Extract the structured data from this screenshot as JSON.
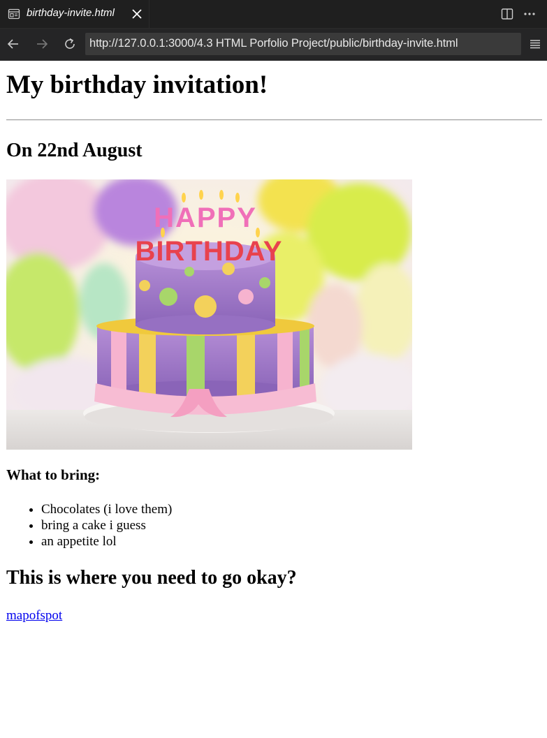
{
  "editor": {
    "tab_title": "birthday-invite.html",
    "tab_icon": "preview-icon",
    "close_icon": "close-icon",
    "split_icon": "split-editor-icon",
    "more_icon": "ellipsis-icon"
  },
  "browser": {
    "url": "http://127.0.0.1:3000/4.3 HTML Porfolio Project/public/birthday-invite.html",
    "back_icon": "arrow-left-icon",
    "forward_icon": "arrow-right-icon",
    "reload_icon": "reload-icon",
    "menu_icon": "hamburger-menu-icon"
  },
  "page": {
    "heading": "My birthday invitation!",
    "date_heading": "On 22nd August",
    "image_subject": "birthday-cake",
    "cake_lettering": {
      "top": "HAPPY",
      "bottom": "BIRTHDAY"
    },
    "bring_heading": "What to bring:",
    "bring_items": [
      "Chocolates (i love them)",
      "bring a cake i guess",
      "an appetite lol"
    ],
    "where_heading": "This is where you need to go okay?",
    "map_link": "mapofspot"
  },
  "colors": {
    "chrome_dark": "#1f1f1f",
    "toolbar": "#252526",
    "url_bar": "#3a3a3a",
    "link": "#0000ee"
  }
}
